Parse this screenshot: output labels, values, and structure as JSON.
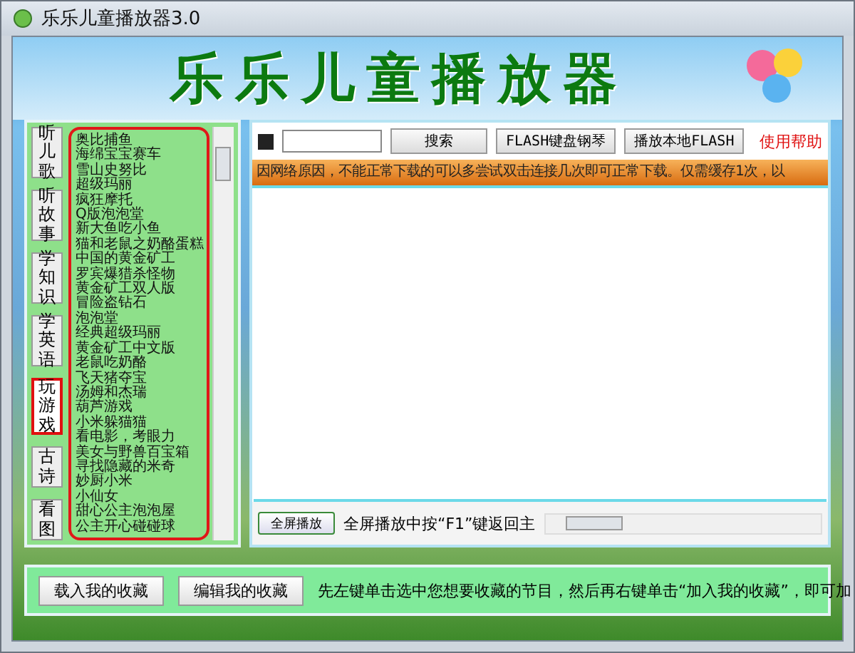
{
  "window": {
    "title": "乐乐儿童播放器3.0"
  },
  "banner": {
    "title": "乐乐儿童播放器"
  },
  "categories": [
    {
      "label": "听儿歌",
      "selected": false
    },
    {
      "label": "听故事",
      "selected": false
    },
    {
      "label": "学知识",
      "selected": false
    },
    {
      "label": "学英语",
      "selected": false
    },
    {
      "label": "玩游戏",
      "selected": true
    },
    {
      "label": "古诗",
      "selected": false
    },
    {
      "label": "看图",
      "selected": false
    }
  ],
  "games": [
    "奥比捕鱼",
    "海绵宝宝赛车",
    "雪山史努比",
    "超级玛丽",
    "疯狂摩托",
    "Q版泡泡堂",
    "新大鱼吃小鱼",
    "猫和老鼠之奶酪蛋糕",
    "中国的黄金矿工",
    "罗宾爆猎杀怪物",
    "黄金矿工双人版",
    "冒险盗钻石",
    "泡泡堂",
    "经典超级玛丽",
    "黄金矿工中文版",
    "老鼠吃奶酪",
    "飞天猪夺宝",
    "汤姆和杰瑞",
    "葫芦游戏",
    "小米躲猫猫",
    "看电影，考眼力",
    "美女与野兽百宝箱",
    "寻找隐藏的米奇",
    "妙厨小米",
    "小仙女",
    "甜心公主泡泡屋",
    "公主开心碰碰球"
  ],
  "toolbar": {
    "buttons": [
      "搜索",
      "FLASH键盘钢琴",
      "播放本地FLASH"
    ],
    "help_link": "使用帮助"
  },
  "notice": "因网络原因，不能正常下载的可以多尝试双击连接几次即可正常下载。仅需缓存1次，以",
  "player": {
    "fullscreen_button": "全屏播放",
    "hint": "全屏播放中按“F1”键返回主"
  },
  "favorites": {
    "buttons": [
      "载入我的收藏",
      "编辑我的收藏"
    ],
    "hint": "先左键单击选中您想要收藏的节目，然后再右键单击“加入我的收藏”，即可加"
  }
}
